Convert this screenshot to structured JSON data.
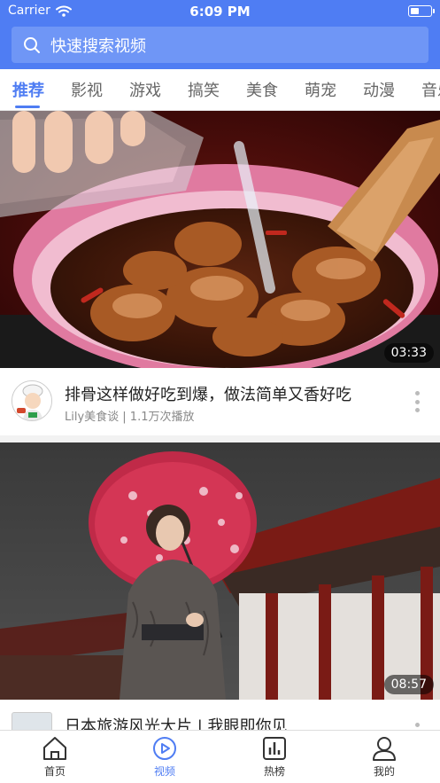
{
  "status_bar": {
    "carrier": "Carrier",
    "time": "6:09 PM",
    "icons": [
      "wifi-icon",
      "battery-icon"
    ]
  },
  "search": {
    "placeholder": "快速搜索视频",
    "icon": "search-icon"
  },
  "category_tabs": [
    {
      "label": "推荐",
      "active": true
    },
    {
      "label": "影视",
      "active": false
    },
    {
      "label": "游戏",
      "active": false
    },
    {
      "label": "搞笑",
      "active": false
    },
    {
      "label": "美食",
      "active": false
    },
    {
      "label": "萌宠",
      "active": false
    },
    {
      "label": "动漫",
      "active": false
    },
    {
      "label": "音乐",
      "active": false
    }
  ],
  "videos": [
    {
      "duration": "03:33",
      "title": "排骨这样做好吃到爆，做法简单又香好吃",
      "meta": "Lily美食谈 | 1.1万次播放",
      "thumbnail": "braised-pork-in-pink-pan",
      "avatar": "chef-avatar"
    },
    {
      "duration": "08:57",
      "title": "日本旅游风光大片 | 我眼即你见",
      "thumbnail": "woman-in-kimono-with-parasol",
      "avatar": "channel-avatar"
    }
  ],
  "tab_bar": [
    {
      "label": "首页",
      "icon": "home-icon",
      "active": false
    },
    {
      "label": "视频",
      "icon": "play-circle-icon",
      "active": true
    },
    {
      "label": "热榜",
      "icon": "chart-icon",
      "active": false
    },
    {
      "label": "我的",
      "icon": "profile-icon",
      "active": false
    }
  ],
  "colors": {
    "accent": "#4f7df3",
    "search_bg": "#6f96f6",
    "inactive_text": "#666666",
    "meta_text": "#888888"
  }
}
